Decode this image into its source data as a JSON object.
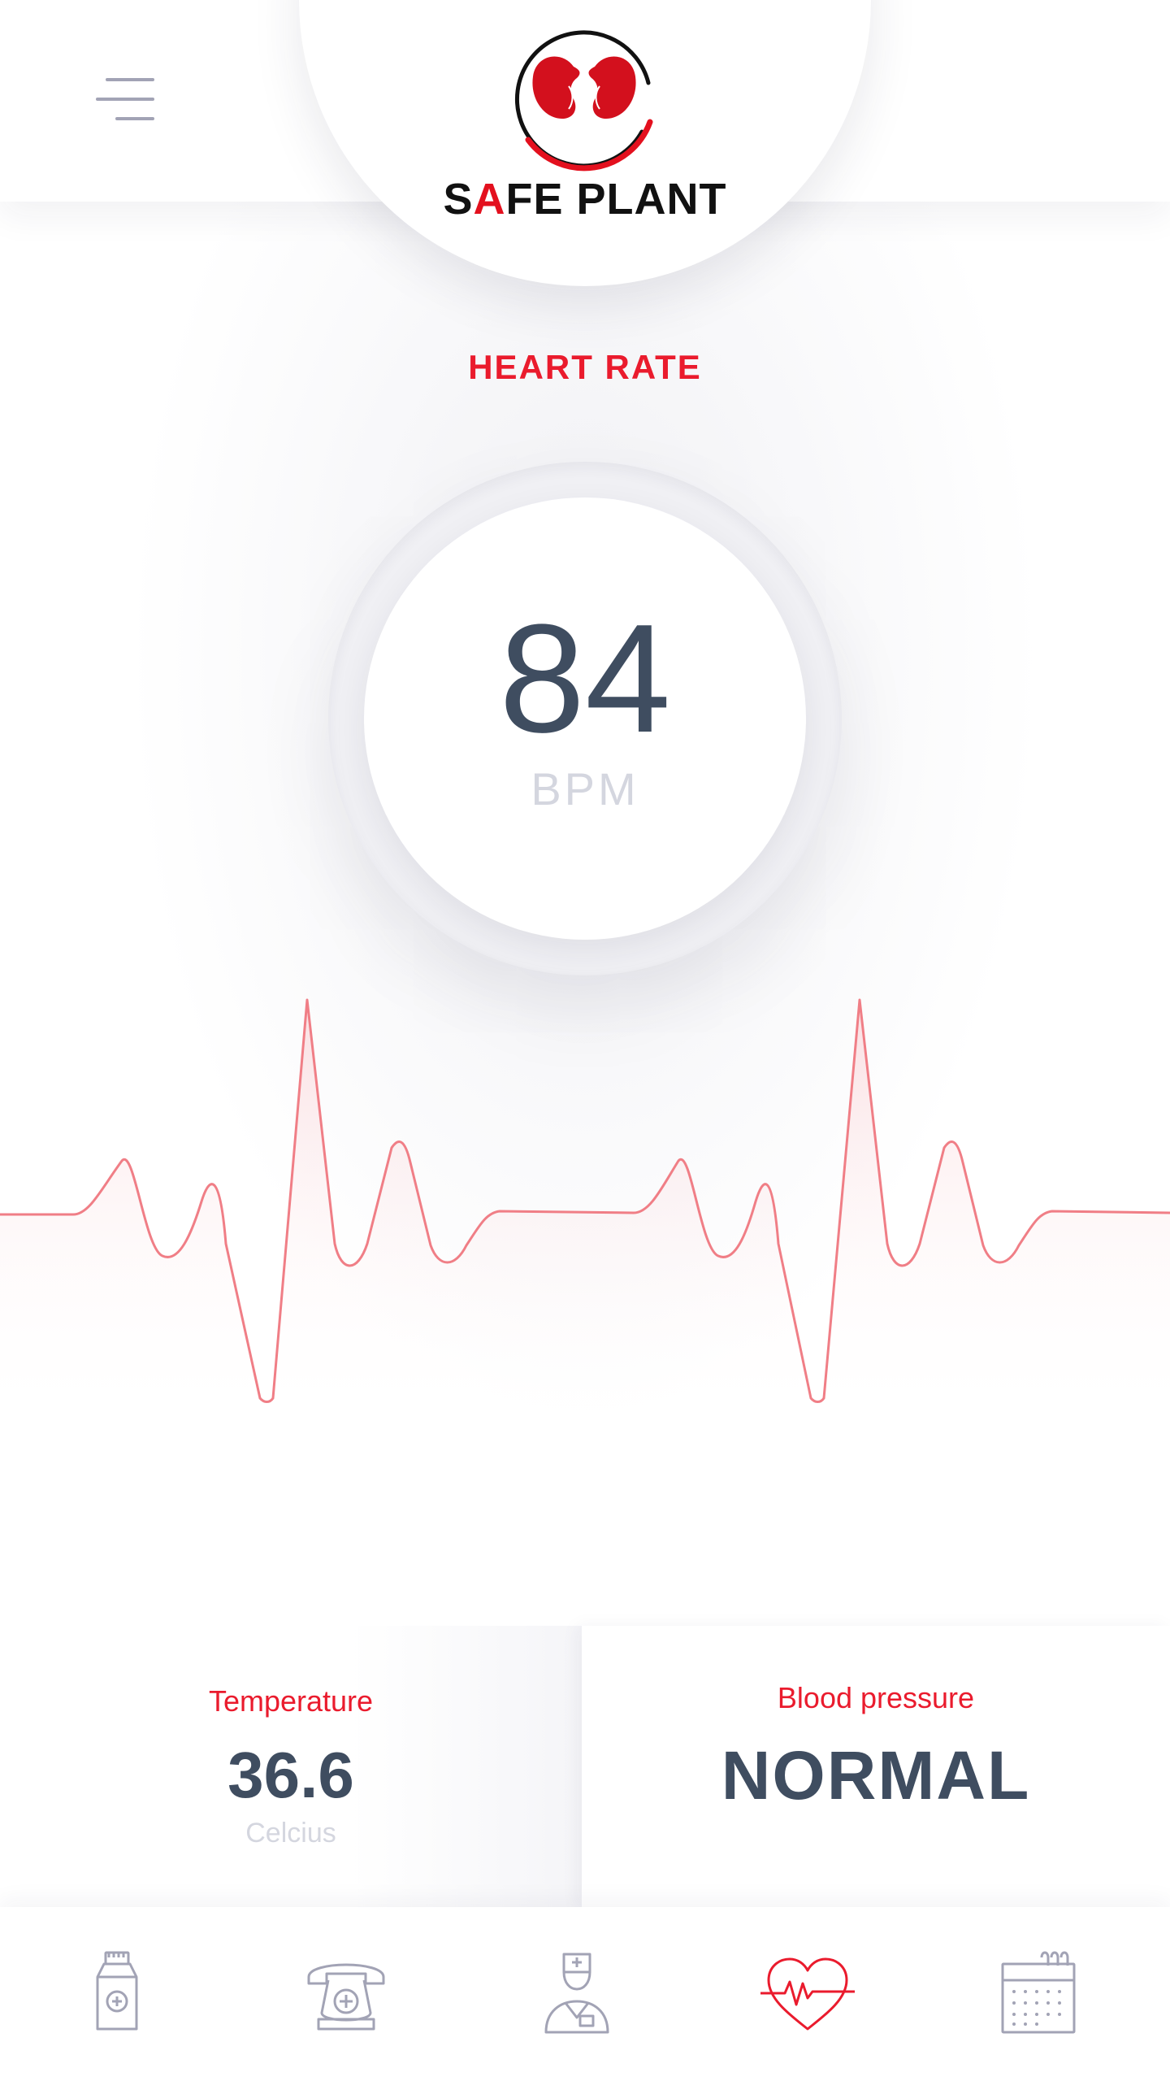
{
  "header": {
    "brand": {
      "prefix": "S",
      "accent_letter": "A",
      "suffix": "FE PLANT"
    },
    "menu_icon": "hamburger-icon",
    "logo_icon": "kidney-logo-icon"
  },
  "heart_rate": {
    "title": "HEART RATE",
    "value": "84",
    "unit": "BPM",
    "waveform_icon": "ecg-waveform"
  },
  "temperature": {
    "label": "Temperature",
    "value": "36.6",
    "unit": "Celcius"
  },
  "blood_pressure": {
    "label": "Blood pressure",
    "value": "NORMAL"
  },
  "nav": {
    "items": [
      {
        "icon": "medicine-bottle-icon",
        "active": false
      },
      {
        "icon": "phone-icon",
        "active": false
      },
      {
        "icon": "nurse-icon",
        "active": false
      },
      {
        "icon": "heart-rate-icon",
        "active": true
      },
      {
        "icon": "calendar-icon",
        "active": false
      }
    ]
  },
  "colors": {
    "accent": "#ea1b2d",
    "value_text": "#3f4d60",
    "muted_text": "#d4d6df",
    "icon_inactive": "#a2a3b5",
    "ecg_line": "#f07e86"
  }
}
